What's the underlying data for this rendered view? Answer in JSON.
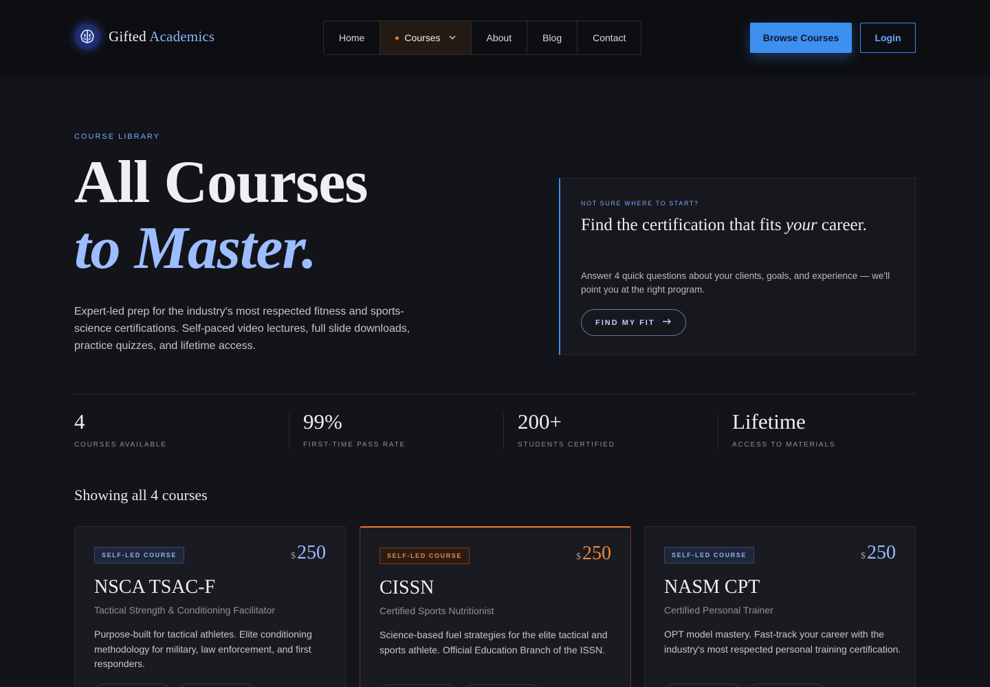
{
  "brand": {
    "name_primary": "Gifted",
    "name_accent": "Academics",
    "logo_icon": "brain-icon"
  },
  "nav": {
    "items": [
      {
        "label": "Home",
        "active": false
      },
      {
        "label": "Courses",
        "active": true,
        "has_dropdown": true
      },
      {
        "label": "About",
        "active": false
      },
      {
        "label": "Blog",
        "active": false
      },
      {
        "label": "Contact",
        "active": false
      }
    ],
    "browse_label": "Browse Courses",
    "login_label": "Login"
  },
  "hero": {
    "eyebrow": "COURSE LIBRARY",
    "title_line1": "All Courses",
    "title_line2": "to Master.",
    "description": "Expert-led prep for the industry's most respected fitness and sports-science certifications. Self-paced video lectures, full slide downloads, practice quizzes, and lifetime access."
  },
  "cta": {
    "eyebrow": "NOT SURE WHERE TO START?",
    "title_start": "Find the certification that fits ",
    "title_emphasis": "your",
    "title_end": " career.",
    "description": "Answer 4 quick questions about your clients, goals, and experience — we'll point you at the right program.",
    "button_label": "FIND MY FIT",
    "button_icon": "arrow-right-icon"
  },
  "stats": [
    {
      "value": "4",
      "label": "COURSES AVAILABLE"
    },
    {
      "value": "99%",
      "label": "FIRST-TIME PASS RATE"
    },
    {
      "value": "200+",
      "label": "STUDENTS CERTIFIED"
    },
    {
      "value": "Lifetime",
      "label": "ACCESS TO MATERIALS"
    }
  ],
  "showing_label": "Showing all 4 courses",
  "courses": [
    {
      "tag": "SELF-LED COURSE",
      "currency": "$",
      "price": "250",
      "name": "NSCA TSAC-F",
      "subtitle": "Tactical Strength & Conditioning Facilitator",
      "description": "Purpose-built for tactical athletes. Elite conditioning methodology for military, law enforcement, and first responders.",
      "featured": false
    },
    {
      "tag": "SELF-LED COURSE",
      "currency": "$",
      "price": "250",
      "name": "CISSN",
      "subtitle": "Certified Sports Nutritionist",
      "description": "Science-based fuel strategies for the elite tactical and sports athlete. Official Education Branch of the ISSN.",
      "featured": true
    },
    {
      "tag": "SELF-LED COURSE",
      "currency": "$",
      "price": "250",
      "name": "NASM CPT",
      "subtitle": "Certified Personal Trainer",
      "description": "OPT model mastery. Fast-track your career with the industry's most respected personal training certification.",
      "featured": false
    }
  ],
  "colors": {
    "background": "#131419",
    "accent_blue": "#3d8ff0",
    "accent_orange": "#f07a2a"
  }
}
